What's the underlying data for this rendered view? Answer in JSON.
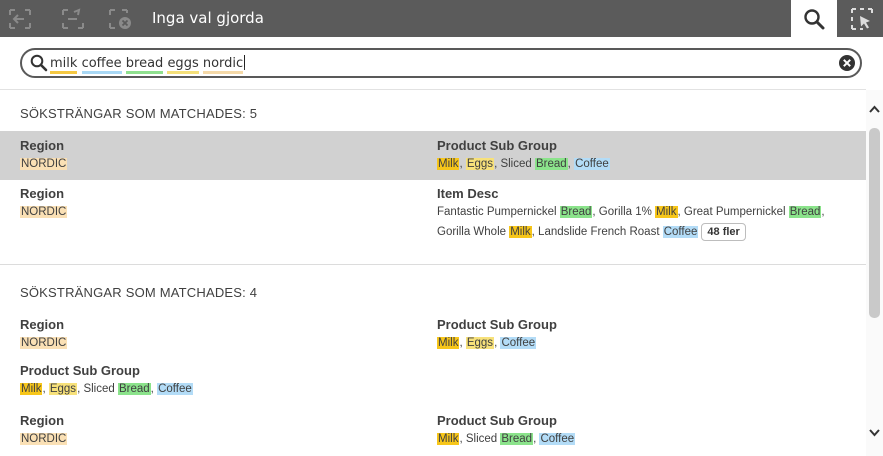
{
  "toolbar": {
    "title": "Inga val gjorda",
    "icons": [
      "step-back-icon",
      "step-forward-icon",
      "clear-selections-icon",
      "search-icon",
      "smart-search-icon"
    ]
  },
  "search": {
    "terms": [
      {
        "text": "milk",
        "color": "#f5c842"
      },
      {
        "text": "coffee",
        "color": "#a8d8f5"
      },
      {
        "text": "bread",
        "color": "#8fe08f"
      },
      {
        "text": "eggs",
        "color": "#f5e07a"
      },
      {
        "text": "nordic",
        "color": "#f5d9a8"
      }
    ]
  },
  "colors": {
    "milk": "#f7c61a",
    "coffee": "#b3dcf7",
    "bread": "#8be38b",
    "eggs": "#f7e17a",
    "nordic": "#fae0b5",
    "selected_row": "#d1d1d1"
  },
  "groups": [
    {
      "header": "SÖKSTRÄNGAR SOM MATCHADES: 5",
      "rows": [
        {
          "selected": true,
          "left": {
            "field": "Region",
            "values": [
              {
                "text": "NORDIC",
                "hl": "nordic"
              }
            ]
          },
          "right": {
            "field": "Product Sub Group",
            "values": [
              {
                "text": "Milk",
                "hl": "milk"
              },
              {
                "text": ", "
              },
              {
                "text": "Eggs",
                "hl": "eggs"
              },
              {
                "text": ", Sliced "
              },
              {
                "text": "Bread",
                "hl": "bread"
              },
              {
                "text": ", "
              },
              {
                "text": "Coffee",
                "hl": "coffee"
              }
            ]
          }
        },
        {
          "selected": false,
          "left": {
            "field": "Region",
            "values": [
              {
                "text": "NORDIC",
                "hl": "nordic"
              }
            ]
          },
          "right": {
            "field": "Item Desc",
            "values": [
              {
                "text": "Fantastic Pumpernickel "
              },
              {
                "text": "Bread",
                "hl": "bread"
              },
              {
                "text": ", Gorilla 1% "
              },
              {
                "text": "Milk",
                "hl": "milk"
              },
              {
                "text": ", Great Pumpernickel "
              },
              {
                "text": "Bread",
                "hl": "bread"
              },
              {
                "text": ","
              },
              {
                "br": true
              },
              {
                "text": "Gorilla Whole "
              },
              {
                "text": "Milk",
                "hl": "milk"
              },
              {
                "text": ", Landslide French Roast "
              },
              {
                "text": "Coffee",
                "hl": "coffee"
              }
            ],
            "more": "48 fler"
          }
        }
      ]
    },
    {
      "header": "SÖKSTRÄNGAR SOM MATCHADES: 4",
      "rows": [
        {
          "selected": false,
          "left": {
            "field": "Region",
            "values": [
              {
                "text": "NORDIC",
                "hl": "nordic"
              }
            ]
          },
          "right": {
            "field": "Product Sub Group",
            "values": [
              {
                "text": "Milk",
                "hl": "milk"
              },
              {
                "text": ", "
              },
              {
                "text": "Eggs",
                "hl": "eggs"
              },
              {
                "text": ", "
              },
              {
                "text": "Coffee",
                "hl": "coffee"
              }
            ]
          }
        },
        {
          "selected": false,
          "left": {
            "field": "Product Sub Group",
            "values": [
              {
                "text": "Milk",
                "hl": "milk"
              },
              {
                "text": ", "
              },
              {
                "text": "Eggs",
                "hl": "eggs"
              },
              {
                "text": ", Sliced "
              },
              {
                "text": "Bread",
                "hl": "bread"
              },
              {
                "text": ", "
              },
              {
                "text": "Coffee",
                "hl": "coffee"
              }
            ]
          }
        },
        {
          "selected": false,
          "left": {
            "field": "Region",
            "values": [
              {
                "text": "NORDIC",
                "hl": "nordic"
              }
            ]
          },
          "right": {
            "field": "Product Sub Group",
            "values": [
              {
                "text": "Milk",
                "hl": "milk"
              },
              {
                "text": ", Sliced "
              },
              {
                "text": "Bread",
                "hl": "bread"
              },
              {
                "text": ", "
              },
              {
                "text": "Coffee",
                "hl": "coffee"
              }
            ]
          }
        }
      ]
    }
  ]
}
